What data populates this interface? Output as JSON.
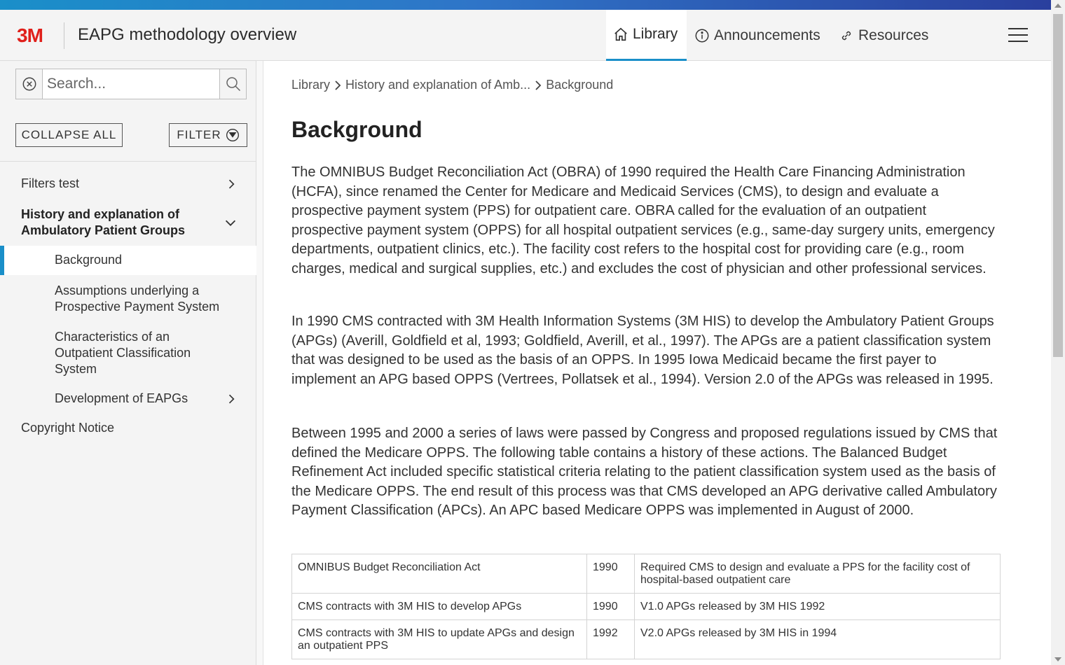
{
  "header": {
    "logo": "3M",
    "title": "EAPG methodology overview",
    "tabs": [
      {
        "label": "Library",
        "icon": "home-icon",
        "active": true
      },
      {
        "label": "Announcements",
        "icon": "info-icon",
        "active": false
      },
      {
        "label": "Resources",
        "icon": "link-icon",
        "active": false
      }
    ]
  },
  "sidebar": {
    "search": {
      "placeholder": "Search...",
      "value": ""
    },
    "collapse_all_label": "COLLAPSE ALL",
    "filter_label": "FILTER",
    "items": [
      {
        "label": "Filters test",
        "level": 1,
        "expandable": true
      },
      {
        "label": "History and explanation of Ambulatory Patient Groups",
        "level": 1,
        "expanded": true
      },
      {
        "label": "Background",
        "level": 2,
        "selected": true
      },
      {
        "label": "Assumptions underlying a Prospective Payment System",
        "level": 2
      },
      {
        "label": "Characteristics of an Outpatient Classification System",
        "level": 2
      },
      {
        "label": "Development of EAPGs",
        "level": 2,
        "expandable": true
      },
      {
        "label": "Copyright Notice",
        "level": 1
      }
    ]
  },
  "breadcrumb": [
    "Library",
    "History and explanation of Amb...",
    "Background"
  ],
  "page": {
    "title": "Background",
    "paragraphs": [
      "The OMNIBUS Budget Reconciliation Act (OBRA) of 1990 required the Health Care Financing Administration (HCFA), since renamed the Center for Medicare and Medicaid Services (CMS), to design and evaluate a prospective payment system (PPS) for outpatient care. OBRA called for the evaluation of an outpatient prospective payment system (OPPS) for all hospital outpatient services (e.g., same-day surgery units, emergency departments, outpatient clinics, etc.). The facility cost refers to the hospital cost for providing care (e.g., room charges, medical and surgical supplies, etc.) and excludes the cost of physician and other professional services.",
      "In 1990 CMS contracted with 3M Health Information Systems (3M HIS) to develop the Ambulatory Patient Groups (APGs) (Averill, Goldfield et al, 1993; Goldfield, Averill, et al., 1997). The APGs are a patient classification system that was designed to be used as the basis of an OPPS. In 1995 Iowa Medicaid became the first payer to implement an APG based OPPS (Vertrees, Pollatsek et al., 1994). Version 2.0 of the APGs was released in 1995.",
      "Between 1995 and 2000 a series of laws were passed by Congress and proposed regulations issued by CMS that defined the Medicare OPPS. The following table contains a history of these actions. The Balanced Budget Refinement Act included specific statistical criteria relating to the patient classification system used as the basis of the Medicare OPPS. The end result of this process was that CMS developed an APG derivative called Ambulatory Payment Classification (APCs). An APC based Medicare OPPS was implemented in August of 2000."
    ],
    "table": [
      {
        "event": "OMNIBUS Budget Reconciliation Act",
        "year": "1990",
        "result": "Required CMS to design and evaluate a PPS for the facility cost of hospital-based outpatient care"
      },
      {
        "event": "CMS contracts with 3M HIS to develop APGs",
        "year": "1990",
        "result": "V1.0 APGs released by 3M HIS 1992"
      },
      {
        "event": "CMS contracts with 3M HIS to update APGs and design an outpatient PPS",
        "year": "1992",
        "result": "V2.0 APGs released by 3M HIS in 1994"
      }
    ]
  },
  "colors": {
    "accent": "#1a8fc9",
    "brand": "#e0201b",
    "sidebar_bg": "#f4f4f4"
  }
}
